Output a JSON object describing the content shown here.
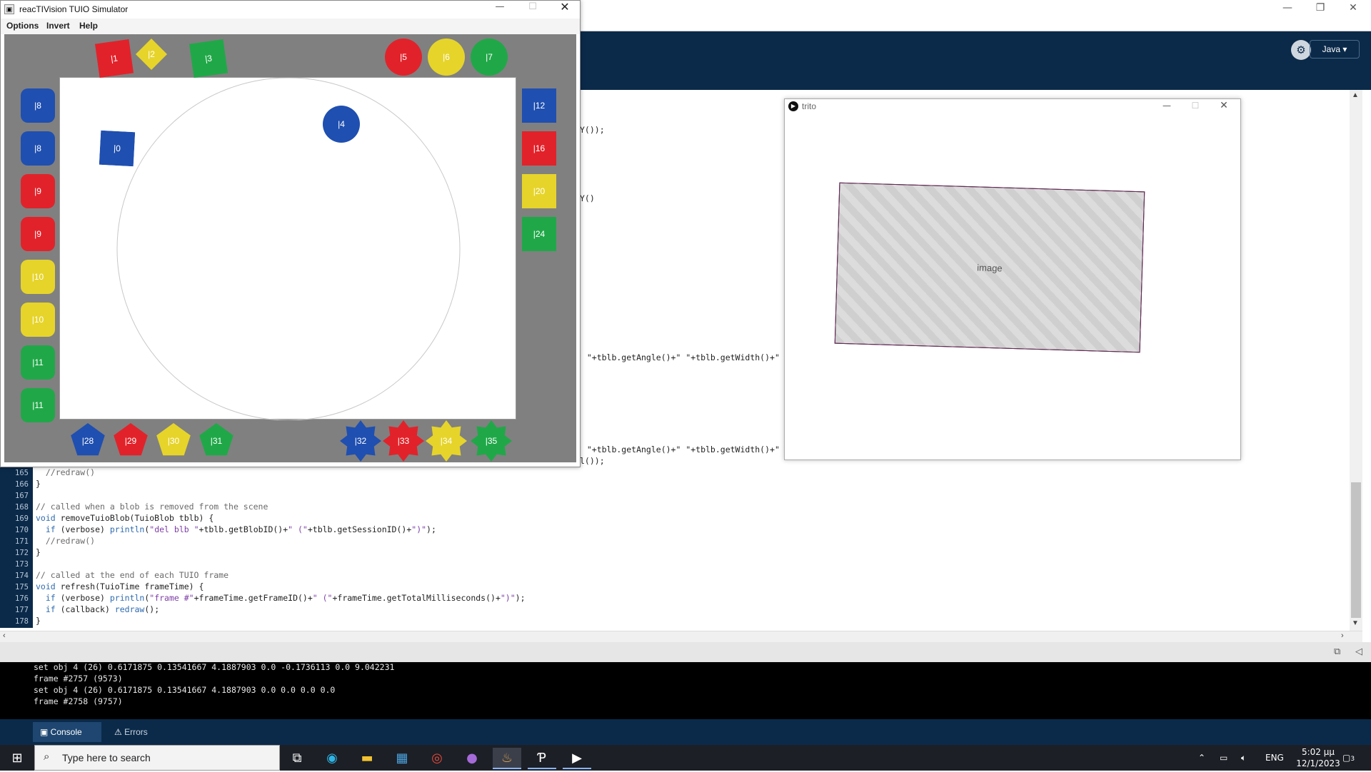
{
  "ide": {
    "window_controls": [
      "—",
      "❐",
      "✕"
    ],
    "mode_label": "Java ▾",
    "debug_icon": "debug-icon",
    "code_fragments": [
      "Y());",
      "Y()",
      "\" \"+tblb.getAngle()+\" \"+tblb.getWidth()+\"",
      "\" \"+tblb.getAngle()+\" \"+tblb.getWidth()+\"",
      "l());"
    ],
    "line_numbers": [
      "165",
      "166",
      "167",
      "168",
      "169",
      "170",
      "171",
      "172",
      "173",
      "174",
      "175",
      "176",
      "177",
      "178"
    ],
    "code_lines": [
      {
        "kind": "cm",
        "text": "  //redraw()"
      },
      {
        "kind": "plain",
        "text": "}"
      },
      {
        "kind": "plain",
        "text": ""
      },
      {
        "kind": "cm",
        "text": "// called when a blob is removed from the scene"
      },
      {
        "kind": "mixed",
        "a": "void",
        "b": " removeTuioBlob(TuioBlob tblb) {"
      },
      {
        "kind": "mixed2",
        "a": "  if",
        "b": " (verbose) ",
        "c": "println",
        "d": "(",
        "e": "\"del blb \"",
        "f": "+tblb.getBlobID()+",
        "g": "\" (\"",
        "h": "+tblb.getSessionID()+",
        "i": "\")\"",
        "j": ");"
      },
      {
        "kind": "cm",
        "text": "  //redraw()"
      },
      {
        "kind": "plain",
        "text": "}"
      },
      {
        "kind": "plain",
        "text": ""
      },
      {
        "kind": "cm",
        "text": "// called at the end of each TUIO frame"
      },
      {
        "kind": "mixed",
        "a": "void",
        "b": " refresh(TuioTime frameTime) {"
      },
      {
        "kind": "mixed2",
        "a": "  if",
        "b": " (verbose) ",
        "c": "println",
        "d": "(",
        "e": "\"frame #\"",
        "f": "+frameTime.getFrameID()+",
        "g": "\" (\"",
        "h": "+frameTime.getTotalMilliseconds()+",
        "i": "\")\"",
        "j": ");"
      },
      {
        "kind": "mixed3",
        "a": "  if",
        "b": " (callback) ",
        "c": "redraw",
        "d": "();"
      },
      {
        "kind": "plain",
        "text": "}"
      }
    ],
    "console_lines": [
      "set obj 4 (26) 0.6171875 0.13541667 4.1887903 0.0 -0.1736113 0.0 9.042231",
      "frame #2757 (9573)",
      "set obj 4 (26) 0.6171875 0.13541667 4.1887903 0.0 0.0 0.0 0.0",
      "frame #2758 (9757)"
    ],
    "tabs": {
      "console": "Console",
      "errors": "Errors"
    }
  },
  "simulator": {
    "title": "reacTIVision TUIO Simulator",
    "window_controls": [
      "—",
      "☐",
      "✕"
    ],
    "menu": [
      "Options",
      "Invert",
      "Help"
    ],
    "fiducials": [
      {
        "id": "1",
        "shape": "square",
        "color": "#e2222a"
      },
      {
        "id": "2",
        "shape": "diamond",
        "color": "#e6d42a"
      },
      {
        "id": "3",
        "shape": "square",
        "color": "#20a848"
      },
      {
        "id": "5",
        "shape": "circle",
        "color": "#e2222a"
      },
      {
        "id": "6",
        "shape": "circle",
        "color": "#e6d42a"
      },
      {
        "id": "7",
        "shape": "circle",
        "color": "#20a848"
      },
      {
        "id": "8",
        "shape": "rounded",
        "color": "#1f4fb0"
      },
      {
        "id": "8",
        "shape": "rounded",
        "color": "#1f4fb0"
      },
      {
        "id": "9",
        "shape": "rounded",
        "color": "#e2222a"
      },
      {
        "id": "9",
        "shape": "rounded",
        "color": "#e2222a"
      },
      {
        "id": "10",
        "shape": "rounded",
        "color": "#e6d42a"
      },
      {
        "id": "10",
        "shape": "rounded",
        "color": "#e6d42a"
      },
      {
        "id": "11",
        "shape": "rounded",
        "color": "#20a848"
      },
      {
        "id": "11",
        "shape": "rounded",
        "color": "#20a848"
      },
      {
        "id": "12",
        "shape": "square",
        "color": "#1f4fb0"
      },
      {
        "id": "16",
        "shape": "square",
        "color": "#e2222a"
      },
      {
        "id": "20",
        "shape": "square",
        "color": "#e6d42a"
      },
      {
        "id": "24",
        "shape": "square",
        "color": "#20a848"
      },
      {
        "id": "28",
        "shape": "pentagon",
        "color": "#1f4fb0"
      },
      {
        "id": "29",
        "shape": "pentagon",
        "color": "#e2222a"
      },
      {
        "id": "30",
        "shape": "pentagon",
        "color": "#e6d42a"
      },
      {
        "id": "31",
        "shape": "pentagon",
        "color": "#20a848"
      },
      {
        "id": "32",
        "shape": "star",
        "color": "#1f4fb0"
      },
      {
        "id": "33",
        "shape": "star",
        "color": "#e2222a"
      },
      {
        "id": "34",
        "shape": "star",
        "color": "#e6d42a"
      },
      {
        "id": "35",
        "shape": "star",
        "color": "#20a848"
      },
      {
        "id": "0",
        "shape": "square",
        "color": "#1f4fb0",
        "on_table": true
      },
      {
        "id": "4",
        "shape": "circle",
        "color": "#1f4fb0",
        "on_table": true
      }
    ]
  },
  "sketch": {
    "title": "trito",
    "window_controls": [
      "—",
      "☐",
      "✕"
    ],
    "image_alt": "image"
  },
  "taskbar": {
    "search_placeholder": "Type here to search",
    "apps": [
      "task-view-icon",
      "edge-icon",
      "file-explorer-icon",
      "store-icon",
      "chrome-icon",
      "github-icon",
      "java-icon",
      "processing-icon",
      "play-icon"
    ],
    "lang": "ENG",
    "time": "5:02 μμ",
    "date": "12/1/2023",
    "notifications": "3"
  }
}
